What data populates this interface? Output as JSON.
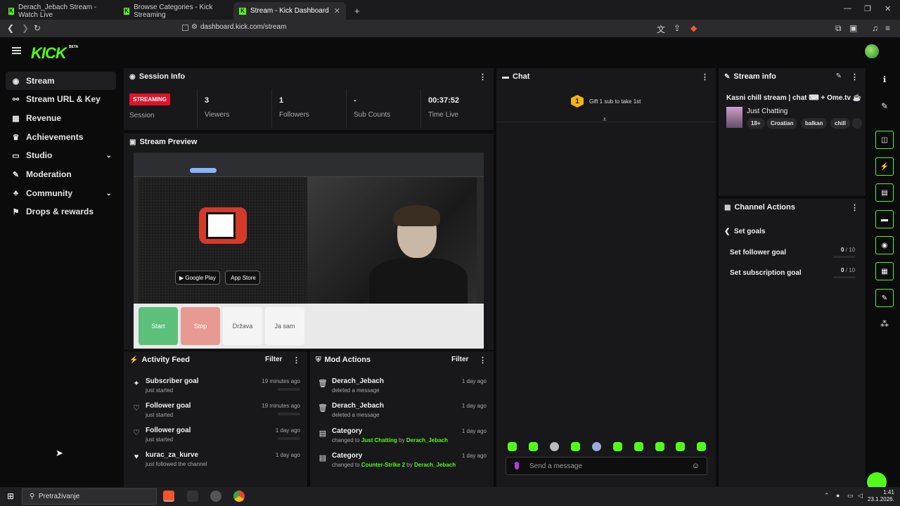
{
  "browser": {
    "tabs": [
      {
        "label": "Derach_Jebach Stream - Watch Live"
      },
      {
        "label": "Browse Categories - Kick Streaming"
      },
      {
        "label": "Stream - Kick Dashboard"
      }
    ],
    "url": "dashboard.kick.com/stream"
  },
  "header": {
    "logo": "KICK",
    "beta": "BETA"
  },
  "sidebar": {
    "items": [
      {
        "label": "Stream",
        "icon": "stream-icon"
      },
      {
        "label": "Stream URL & Key",
        "icon": "link-icon"
      },
      {
        "label": "Revenue",
        "icon": "revenue-icon"
      },
      {
        "label": "Achievements",
        "icon": "trophy-icon"
      },
      {
        "label": "Studio",
        "icon": "studio-icon"
      },
      {
        "label": "Moderation",
        "icon": "wrench-icon"
      },
      {
        "label": "Community",
        "icon": "community-icon"
      },
      {
        "label": "Drops & rewards",
        "icon": "gift-icon"
      }
    ]
  },
  "session": {
    "title": "Session Info",
    "badge": "STREAMING",
    "session_label": "Session",
    "viewers_val": "3",
    "viewers_label": "Viewers",
    "followers_val": "1",
    "followers_label": "Followers",
    "subs_val": "-",
    "subs_label": "Sub Counts",
    "time_val": "00:37:52",
    "time_label": "Time Live"
  },
  "preview": {
    "title": "Stream Preview",
    "google_play": "Google Play",
    "app_store": "App Store",
    "start": "Start",
    "stop": "Stop",
    "drzava": "Država",
    "ja_sam": "Ja sam"
  },
  "activity": {
    "title": "Activity Feed",
    "filter": "Filter",
    "rows": [
      {
        "title": "Subscriber goal",
        "sub": "just started",
        "time": "19 minutes ago"
      },
      {
        "title": "Follower goal",
        "sub": "just started",
        "time": "19 minutes ago"
      },
      {
        "title": "Follower goal",
        "sub": "just started",
        "time": "1 day ago"
      },
      {
        "title": "kurac_za_kurve",
        "sub": "just followed the channel",
        "time": "1 day ago"
      }
    ]
  },
  "mod": {
    "title": "Mod Actions",
    "filter": "Filter",
    "rows": [
      {
        "title": "Derach_Jebach",
        "sub": "deleted a message",
        "time": "1 day ago"
      },
      {
        "title": "Derach_Jebach",
        "sub": "deleted a message",
        "time": "1 day ago"
      },
      {
        "title": "Category",
        "sub_pre": "changed to",
        "sub_cat": "Just Chatting",
        "sub_by": "by",
        "sub_user": "Derach_Jebach",
        "time": "1 day ago"
      },
      {
        "title": "Category",
        "sub_pre": "changed to",
        "sub_cat": "Counter-Strike 2",
        "sub_by": "by",
        "sub_user": "Derach_Jebach",
        "time": "1 day ago"
      }
    ]
  },
  "chat": {
    "title": "Chat",
    "gift_rank": "1",
    "gift_text": "Gift 1 sub to take 1st",
    "placeholder": "Send a message"
  },
  "stream_info": {
    "title": "Stream info",
    "stream_title": "Kasni chill stream | chat ⌨ + Ome.tv ☕",
    "category": "Just Chatting",
    "tags": [
      "18+",
      "Croatian",
      "balkan",
      "chill"
    ]
  },
  "channel_actions": {
    "title": "Channel Actions",
    "back_label": "Set goals",
    "follower_goal": "Set follower goal",
    "follower_cur": "0",
    "follower_max": "/ 10",
    "sub_goal": "Set subscription goal",
    "sub_cur": "0",
    "sub_max": "/ 10"
  },
  "taskbar": {
    "search": "Pretraživanje",
    "time": "1:41",
    "date": "23.1.2026."
  },
  "colors": {
    "accent": "#53fc18",
    "streaming": "#e0132b",
    "panel": "#18181a"
  }
}
